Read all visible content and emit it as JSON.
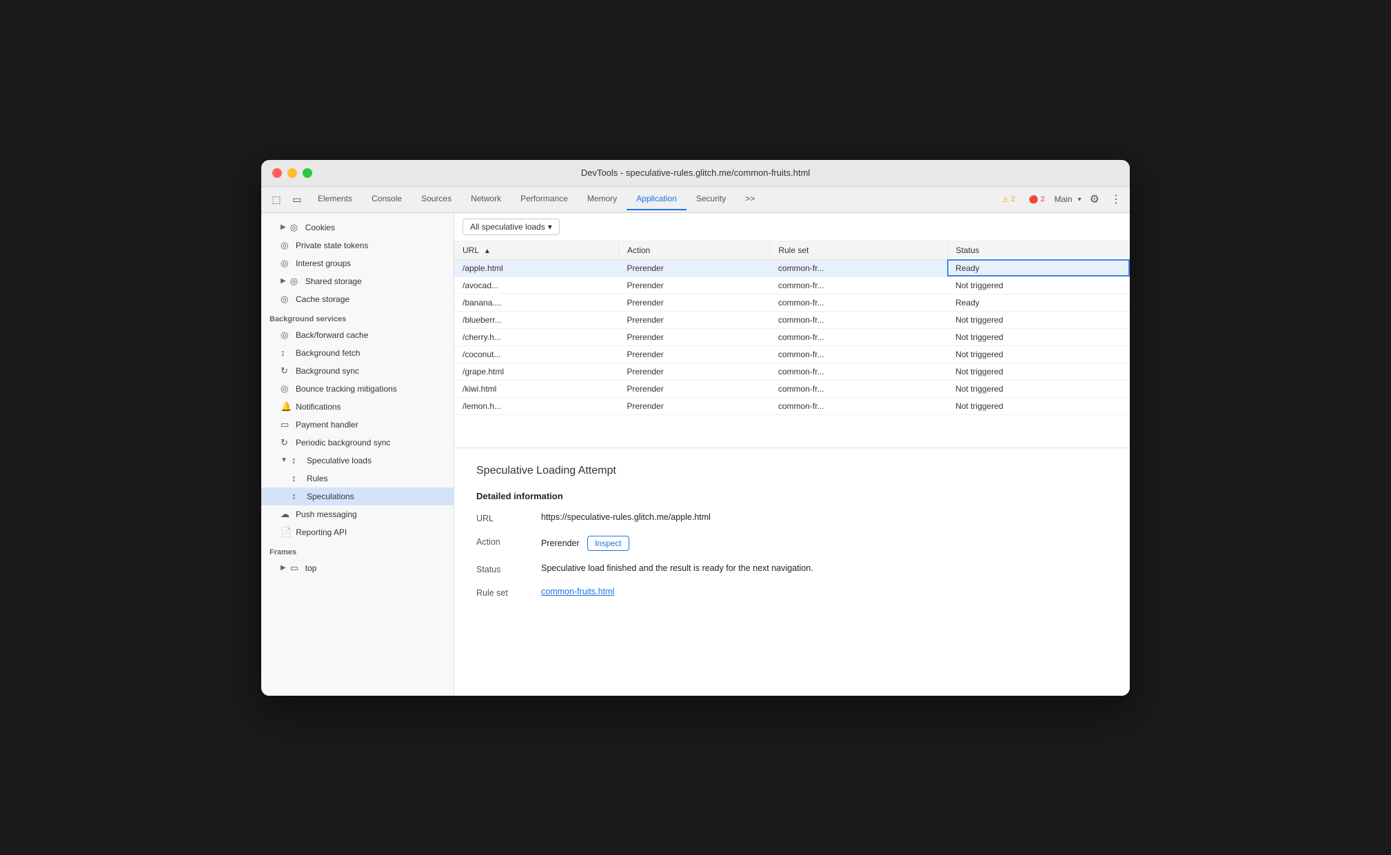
{
  "window": {
    "title": "DevTools - speculative-rules.glitch.me/common-fruits.html"
  },
  "toolbar": {
    "tabs": [
      {
        "id": "elements",
        "label": "Elements",
        "active": false
      },
      {
        "id": "console",
        "label": "Console",
        "active": false
      },
      {
        "id": "sources",
        "label": "Sources",
        "active": false
      },
      {
        "id": "network",
        "label": "Network",
        "active": false
      },
      {
        "id": "performance",
        "label": "Performance",
        "active": false
      },
      {
        "id": "memory",
        "label": "Memory",
        "active": false
      },
      {
        "id": "application",
        "label": "Application",
        "active": true
      },
      {
        "id": "security",
        "label": "Security",
        "active": false
      }
    ],
    "more_label": ">>",
    "warn_count": "2",
    "err_count": "2",
    "main_label": "Main",
    "gear_icon": "⚙",
    "dots_icon": "⋮"
  },
  "sidebar": {
    "sections": {
      "storage": {
        "cookies_label": "Cookies",
        "private_state_tokens_label": "Private state tokens",
        "interest_groups_label": "Interest groups",
        "shared_storage_label": "Shared storage",
        "cache_storage_label": "Cache storage"
      },
      "background_services": {
        "header": "Background services",
        "back_forward_cache": "Back/forward cache",
        "background_fetch": "Background fetch",
        "background_sync": "Background sync",
        "bounce_tracking": "Bounce tracking mitigations",
        "notifications": "Notifications",
        "payment_handler": "Payment handler",
        "periodic_background_sync": "Periodic background sync",
        "speculative_loads": "Speculative loads",
        "rules": "Rules",
        "speculations": "Speculations",
        "push_messaging": "Push messaging",
        "reporting_api": "Reporting API"
      },
      "frames": {
        "header": "Frames",
        "top": "top"
      }
    }
  },
  "filter": {
    "label": "All speculative loads",
    "dropdown_arrow": "▾"
  },
  "table": {
    "columns": [
      "URL",
      "Action",
      "Rule set",
      "Status"
    ],
    "rows": [
      {
        "url": "/apple.html",
        "action": "Prerender",
        "rule_set": "common-fr...",
        "status": "Ready",
        "selected": true
      },
      {
        "url": "/avocad...",
        "action": "Prerender",
        "rule_set": "common-fr...",
        "status": "Not triggered",
        "selected": false
      },
      {
        "url": "/banana....",
        "action": "Prerender",
        "rule_set": "common-fr...",
        "status": "Ready",
        "selected": false
      },
      {
        "url": "/blueberr...",
        "action": "Prerender",
        "rule_set": "common-fr...",
        "status": "Not triggered",
        "selected": false
      },
      {
        "url": "/cherry.h...",
        "action": "Prerender",
        "rule_set": "common-fr...",
        "status": "Not triggered",
        "selected": false
      },
      {
        "url": "/coconut...",
        "action": "Prerender",
        "rule_set": "common-fr...",
        "status": "Not triggered",
        "selected": false
      },
      {
        "url": "/grape.html",
        "action": "Prerender",
        "rule_set": "common-fr...",
        "status": "Not triggered",
        "selected": false
      },
      {
        "url": "/kiwi.html",
        "action": "Prerender",
        "rule_set": "common-fr...",
        "status": "Not triggered",
        "selected": false
      },
      {
        "url": "/lemon.h...",
        "action": "Prerender",
        "rule_set": "common-fr...",
        "status": "Not triggered",
        "selected": false
      }
    ]
  },
  "detail": {
    "title": "Speculative Loading Attempt",
    "section_title": "Detailed information",
    "url_label": "URL",
    "url_value": "https://speculative-rules.glitch.me/apple.html",
    "action_label": "Action",
    "action_value": "Prerender",
    "inspect_label": "Inspect",
    "status_label": "Status",
    "status_value": "Speculative load finished and the result is ready for the next navigation.",
    "rule_set_label": "Rule set",
    "rule_set_value": "common-fruits.html"
  },
  "colors": {
    "active_tab": "#1a73e8",
    "selected_row_bg": "#e8f0fe",
    "selected_row_border": "#4285f4",
    "inspect_btn_color": "#1a73e8",
    "link_color": "#1a73e8"
  }
}
